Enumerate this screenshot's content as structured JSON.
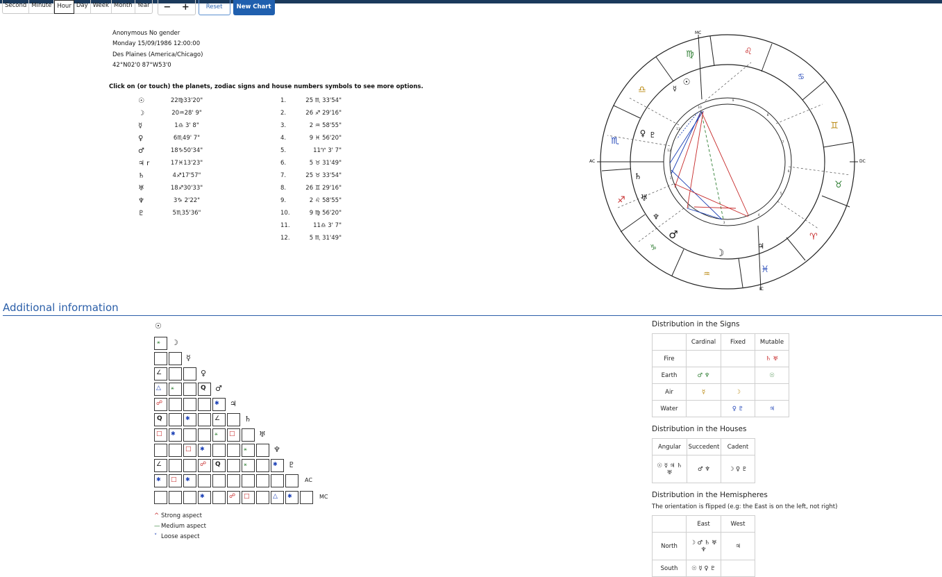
{
  "toolbar": {
    "units": [
      "Second",
      "Minute",
      "Hour",
      "Day",
      "Week",
      "Month",
      "Year"
    ],
    "selected_unit": "Hour",
    "minus": "−",
    "plus": "+",
    "reset": "Reset",
    "new_chart": "New Chart"
  },
  "person": {
    "line1": "Anonymous No gender",
    "line2": "Monday 15/09/1986 12:00:00",
    "line3": "Des Plaines (America/Chicago)",
    "line4": "42°N02'0 87°W53'0"
  },
  "hint": "Click on (or touch) the planets, zodiac signs and house numbers symbols to see more options.",
  "planets": [
    {
      "icon": "sun-icon",
      "symbol": "☉",
      "value": "22♍33'20\""
    },
    {
      "icon": "moon-icon",
      "symbol": "☽",
      "value": "20♒28' 9\""
    },
    {
      "icon": "mercury-icon",
      "symbol": "☿",
      "value": "1♎ 3' 8\""
    },
    {
      "icon": "venus-icon",
      "symbol": "♀",
      "value": "6♏49' 7\""
    },
    {
      "icon": "mars-icon",
      "symbol": "♂",
      "value": "18♑50'34\""
    },
    {
      "icon": "jupiter-icon",
      "symbol": "♃ r",
      "value": "17♓13'23\""
    },
    {
      "icon": "saturn-icon",
      "symbol": "♄",
      "value": "4♐17'57\""
    },
    {
      "icon": "uranus-icon",
      "symbol": "♅",
      "value": "18♐30'33\""
    },
    {
      "icon": "neptune-icon",
      "symbol": "♆",
      "value": "3♑ 2'22\""
    },
    {
      "icon": "pluto-icon",
      "symbol": "♇",
      "value": "5♏35'36\""
    }
  ],
  "houses": [
    {
      "num": "1.",
      "value": "25 ♏ 33'54\""
    },
    {
      "num": "2.",
      "value": "26 ♐ 29'16\""
    },
    {
      "num": "3.",
      "value": "2 ♒ 58'55\""
    },
    {
      "num": "4.",
      "value": "9 ♓ 56'20\""
    },
    {
      "num": "5.",
      "value": "11♈ 3' 7\""
    },
    {
      "num": "6.",
      "value": "5 ♉ 31'49\""
    },
    {
      "num": "7.",
      "value": "25 ♉ 33'54\""
    },
    {
      "num": "8.",
      "value": "26 ♊ 29'16\""
    },
    {
      "num": "9.",
      "value": "2 ♌ 58'55\""
    },
    {
      "num": "10.",
      "value": "9 ♍ 56'20\""
    },
    {
      "num": "11.",
      "value": "11♎ 3' 7\""
    },
    {
      "num": "12.",
      "value": "5 ♏ 31'49\""
    }
  ],
  "chart_wheel": {
    "mc": "MC",
    "ic": "IC",
    "ac": "AC",
    "dc": "DC",
    "signs": [
      "♍",
      "♌",
      "♋",
      "♊",
      "♉",
      "♈",
      "♓",
      "♒",
      "♑",
      "♐",
      "♏",
      "♎"
    ],
    "planets": [
      "☉",
      "☿",
      "♀",
      "♇",
      "♄",
      "♅",
      "♆",
      "♂",
      "☽",
      "♃"
    ],
    "house_numbers": [
      "1",
      "2",
      "3",
      "4",
      "5",
      "6",
      "7",
      "8",
      "9",
      "10",
      "11",
      "12"
    ]
  },
  "additional_info": "Additional information",
  "aspect_grid": {
    "planets": [
      "☉",
      "☽",
      "☿",
      "♀",
      "♂",
      "♃",
      "♄",
      "♅",
      "♆",
      "♇",
      "AC",
      "MC"
    ],
    "legend": [
      {
        "mark": "^",
        "text": "Strong aspect",
        "color": "#c62828"
      },
      {
        "mark": "—",
        "text": "Medium aspect",
        "color": "#2e7d32"
      },
      {
        "mark": "˅",
        "text": "Loose aspect",
        "color": "#1a3fb5"
      }
    ]
  },
  "signs_table": {
    "title": "Distribution in the Signs",
    "columns": [
      "Cardinal",
      "Fixed",
      "Mutable"
    ],
    "rows": [
      {
        "label": "Fire",
        "cells": [
          "",
          "",
          "♄ ♅"
        ]
      },
      {
        "label": "Earth",
        "cells": [
          "♂ ♆",
          "",
          "☉"
        ]
      },
      {
        "label": "Air",
        "cells": [
          "☿",
          "☽",
          ""
        ]
      },
      {
        "label": "Water",
        "cells": [
          "",
          "♀ ♇",
          "♃"
        ]
      }
    ]
  },
  "houses_table": {
    "title": "Distribution in the Houses",
    "columns": [
      "Angular",
      "Succedent",
      "Cadent"
    ],
    "cells": [
      "☉ ☿ ♃ ♄ ♅",
      "♂ ♆",
      "☽ ♀ ♇"
    ]
  },
  "hemi_table": {
    "title": "Distribution in the Hemispheres",
    "note": "The orientation is flipped (e.g: the East is on the left, not right)",
    "columns": [
      "East",
      "West"
    ],
    "rows": [
      {
        "label": "North",
        "cells": [
          "☽ ♂ ♄ ♅ ♆",
          "♃"
        ]
      },
      {
        "label": "South",
        "cells": [
          "☉ ☿ ♀ ♇",
          ""
        ]
      }
    ]
  }
}
